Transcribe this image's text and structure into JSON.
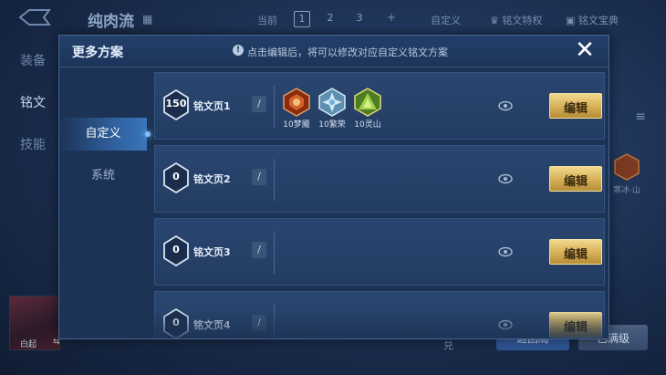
{
  "background": {
    "hero_title": "纯肉流",
    "toolbar": {
      "current_label": "当前",
      "pages": [
        "1",
        "2",
        "3"
      ],
      "add": "+",
      "custom": "自定义",
      "rune_feature": "铭文特权",
      "rune_book": "铭文宝典"
    },
    "side_nav": [
      "装备",
      "铭文",
      "技能"
    ],
    "right_rune_label": "寒冰·山",
    "hero_avatar_name": "白起",
    "avatar_swap": "⇆",
    "bottom_label": "兑",
    "btn_blue": "返回局",
    "btn_gray": "已满级"
  },
  "modal": {
    "title": "更多方案",
    "hint": "点击编辑后，将可以修改对应自定义铭文方案",
    "close": "✕",
    "tabs": [
      {
        "label": "自定义",
        "active": true
      },
      {
        "label": "系统",
        "active": false
      }
    ],
    "edit_label": "编辑",
    "pages": [
      {
        "level": "150",
        "name": "铭文页1",
        "runes": [
          {
            "label": "10梦魇",
            "color": "#c8541e"
          },
          {
            "label": "10繁荣",
            "color": "#7fb7d8"
          },
          {
            "label": "10灵山",
            "color": "#7fb43a"
          }
        ]
      },
      {
        "level": "0",
        "name": "铭文页2",
        "runes": []
      },
      {
        "level": "0",
        "name": "铭文页3",
        "runes": []
      },
      {
        "level": "0",
        "name": "铭文页4",
        "runes": []
      }
    ]
  },
  "colors": {
    "gold": "#d7b35a",
    "panel": "#1d3356",
    "accent": "#3a75bc"
  }
}
